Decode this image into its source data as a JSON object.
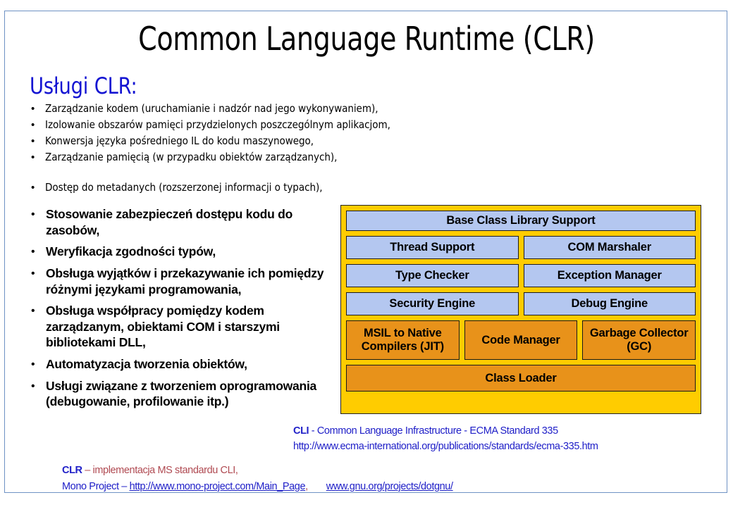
{
  "slide": {
    "title": "Common Language Runtime (CLR)",
    "services_heading": "Usługi CLR:",
    "accent_blue": "#1414d2",
    "frame_border": "#6f92c4",
    "diagram_frame": "#ffcc00",
    "diagram_blue": "#b4c7f0",
    "diagram_orange": "#e8921a",
    "note_maroon": "#b04a52"
  },
  "thin_bullets": [
    {
      "marker": "•",
      "text": "Zarządzanie kodem (uruchamianie i nadzór nad jego wykonywaniem),",
      "spaced": false
    },
    {
      "marker": "•",
      "text": "Izolowanie obszarów pamięci przydzielonych poszczególnym aplikacjom,",
      "spaced": false
    },
    {
      "marker": "•",
      "text": "Konwersja języka pośredniego IL do kodu maszynowego,",
      "spaced": false
    },
    {
      "marker": "•",
      "text": "Zarządzanie pamięcią (w przypadku obiektów zarządzanych),",
      "spaced": false
    },
    {
      "marker": "•",
      "text": "Dostęp do metadanych (rozszerzonej informacji o typach),",
      "spaced": true
    }
  ],
  "bold_bullets": [
    {
      "marker": "•",
      "text": "Stosowanie zabezpieczeń dostępu kodu do zasobów,"
    },
    {
      "marker": "•",
      "text": "Weryfikacja zgodności typów,"
    },
    {
      "marker": "•",
      "text": "Obsługa wyjątków i przekazywanie ich pomiędzy różnymi językami programowania,"
    },
    {
      "marker": "•",
      "text": "Obsługa współpracy pomiędzy kodem zarządzanym, obiektami COM i starszymi bibliotekami DLL,"
    },
    {
      "marker": "•",
      "text": "Automatyzacja tworzenia obiektów,"
    },
    {
      "marker": "•",
      "text": "Usługi związane z tworzeniem oprogramowania (debugowanie, profilowanie itp.)"
    }
  ],
  "diagram": {
    "row1": [
      {
        "label": "Base Class Library Support",
        "color": "blue"
      }
    ],
    "row2": [
      {
        "label": "Thread Support",
        "color": "blue"
      },
      {
        "label": "COM Marshaler",
        "color": "blue"
      }
    ],
    "row3": [
      {
        "label": "Type Checker",
        "color": "blue"
      },
      {
        "label": "Exception Manager",
        "color": "blue"
      }
    ],
    "row4": [
      {
        "label": "Security Engine",
        "color": "blue"
      },
      {
        "label": "Debug Engine",
        "color": "blue"
      }
    ],
    "row5": [
      {
        "label": "MSIL to Native Compilers (JIT)",
        "color": "orange"
      },
      {
        "label": "Code Manager",
        "color": "orange"
      },
      {
        "label": "Garbage Collector (GC)",
        "color": "orange"
      }
    ],
    "row6": [
      {
        "label": "Class Loader",
        "color": "orange"
      }
    ]
  },
  "cli_note": {
    "abbrev": "CLI",
    "expansion": " - Common Language Infrastructure - ECMA Standard 335",
    "url": "http://www.ecma-international.org/publications/standards/ecma-335.htm"
  },
  "clr_note": {
    "abbrev": "CLR",
    "description": " – implementacja MS standardu CLI,",
    "mono_label": "Mono Project – ",
    "mono_url": "http://www.mono-project.com/Main_Page",
    "mono_comma": ",",
    "gnu_url": "www.gnu.org/projects/dotgnu/"
  }
}
